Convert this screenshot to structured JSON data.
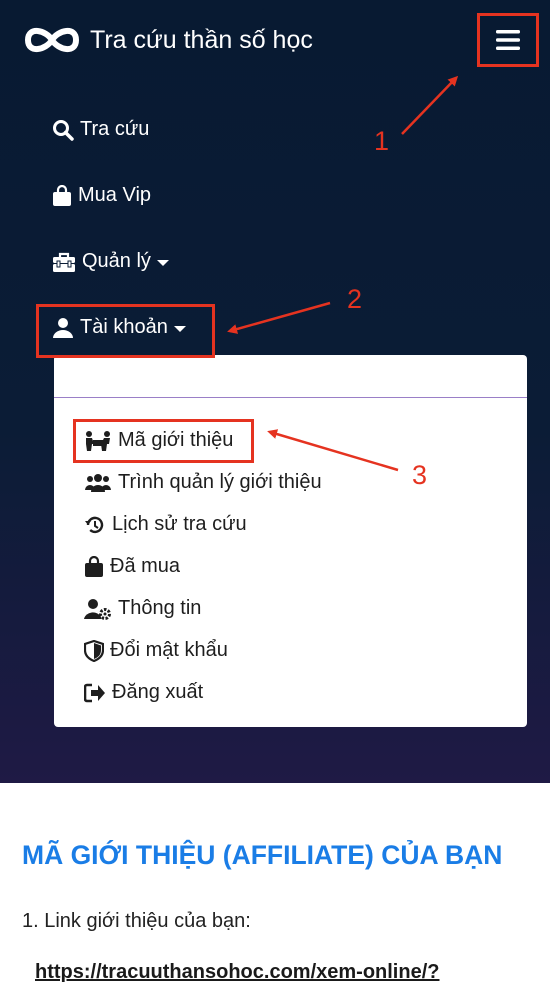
{
  "brand": {
    "title": "Tra cứu thần số học",
    "logo_icon": "infinity-logo-icon"
  },
  "menu_toggle_icon": "hamburger-icon",
  "nav": {
    "items": [
      {
        "label": "Tra cứu",
        "icon": "search-icon"
      },
      {
        "label": "Mua Vip",
        "icon": "shopping-bag-icon"
      },
      {
        "label": "Quản lý",
        "icon": "toolbox-icon",
        "dropdown": true
      },
      {
        "label": "Tài khoản",
        "icon": "user-icon",
        "dropdown": true,
        "expanded": true
      }
    ]
  },
  "account_menu": {
    "items": [
      {
        "label": "Mã giới thiệu",
        "icon": "people-carry-icon"
      },
      {
        "label": "Trình quản lý giới thiệu",
        "icon": "users-icon"
      },
      {
        "label": "Lịch sử tra cứu",
        "icon": "history-icon"
      },
      {
        "label": "Đã mua",
        "icon": "shopping-bag-icon"
      },
      {
        "label": "Thông tin",
        "icon": "user-cog-icon"
      },
      {
        "label": "Đổi mật khẩu",
        "icon": "shield-icon"
      },
      {
        "label": "Đăng xuất",
        "icon": "sign-out-icon"
      }
    ]
  },
  "annotations": {
    "marker_1": "1",
    "marker_2": "2",
    "marker_3": "3",
    "color": "#e53320"
  },
  "content": {
    "title": "MÃ GIỚI THIỆU (AFFILIATE) CỦA BẠN",
    "line1": "1. Link giới thiệu của bạn:",
    "link": "https://tracuuthansohoc.com/xem-online/?"
  },
  "colors": {
    "navbar": "#0b1c36",
    "title_blue": "#1a7de6",
    "annotation_red": "#e53320"
  }
}
